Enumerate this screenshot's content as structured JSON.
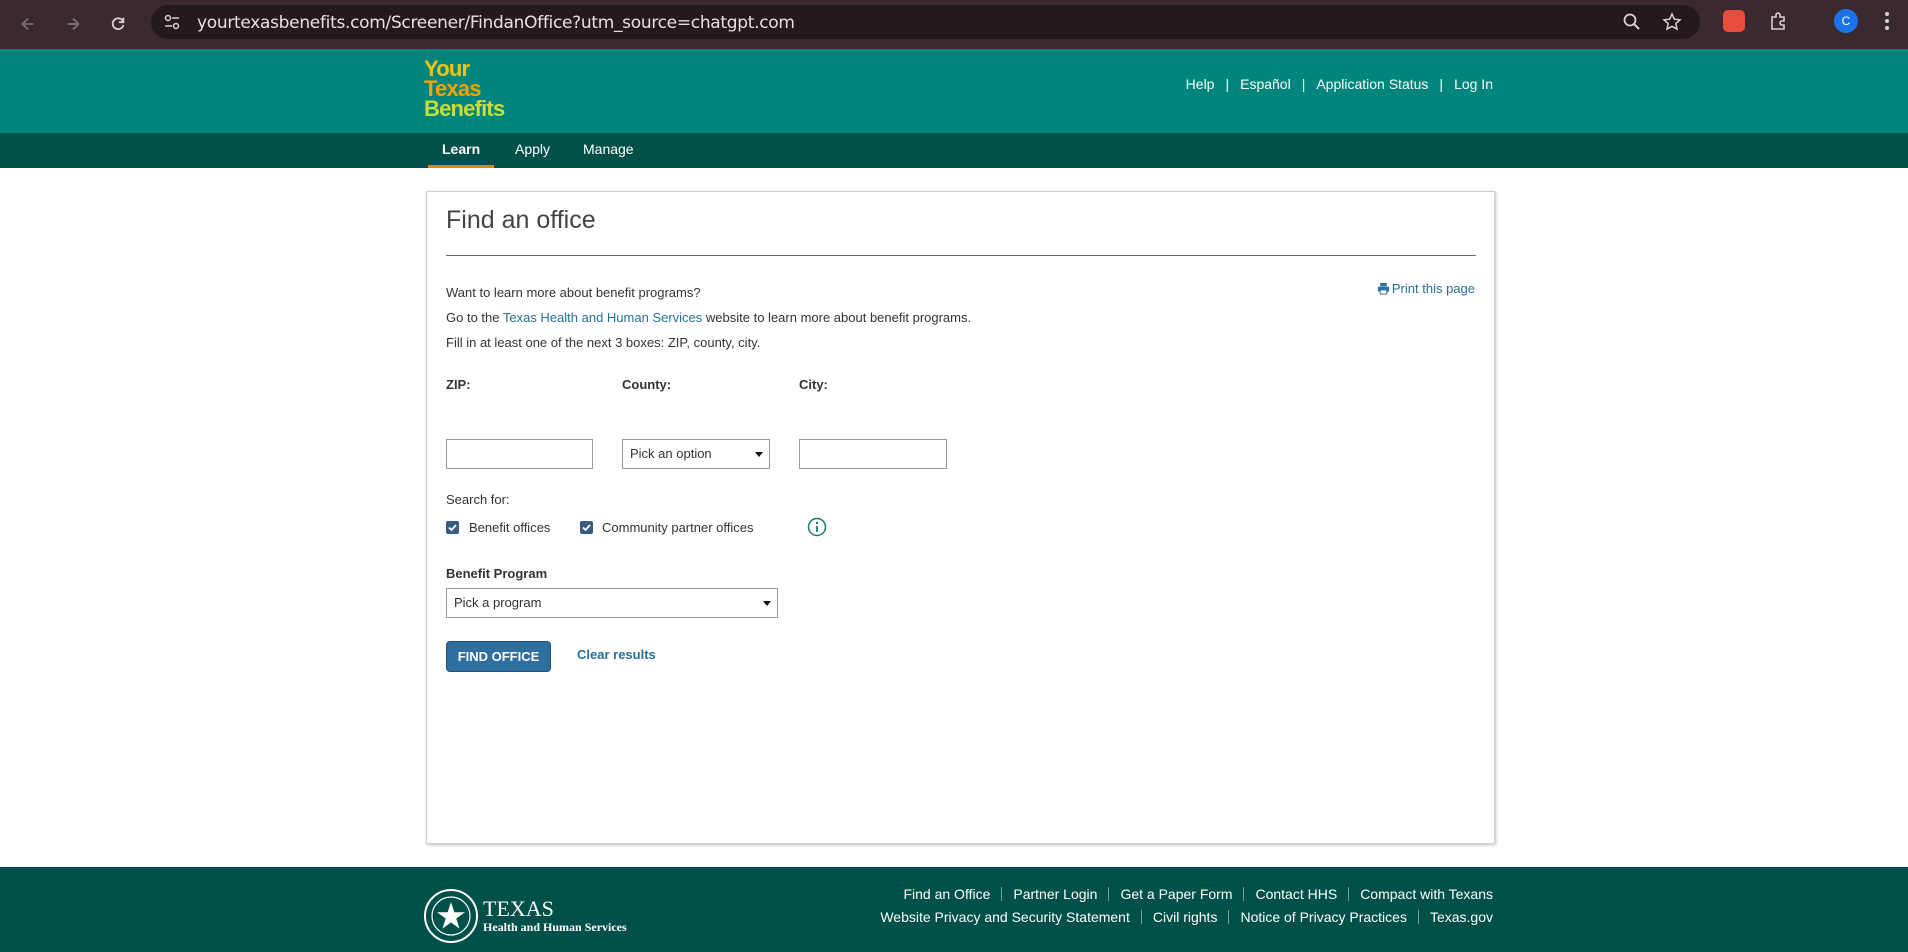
{
  "browser": {
    "url": "yourtexasbenefits.com/Screener/FindanOffice?utm_source=chatgpt.com",
    "profile_initial": "C"
  },
  "header": {
    "logo": [
      "Your",
      "Texas",
      "Benefits"
    ],
    "utility_links": [
      "Help",
      "Español",
      "Application Status",
      "Log In"
    ],
    "separator": "|"
  },
  "nav": {
    "tabs": [
      "Learn",
      "Apply",
      "Manage"
    ],
    "active_tab": "Learn"
  },
  "main": {
    "title": "Find an office",
    "print_label": "Print this page",
    "intro": "Want to learn more about benefit programs?",
    "go_prefix": "Go to the ",
    "hhs_link": "Texas Health and Human Services",
    "go_suffix": " website to learn more about benefit programs.",
    "fill_note": "Fill in at least one of the next 3 boxes: ZIP, county, city.",
    "zip_label": "ZIP:",
    "zip_value": "",
    "county_label": "County:",
    "county_value": "Pick an option",
    "city_label": "City:",
    "city_value": "",
    "search_for_label": "Search for:",
    "benefit_offices_label": "Benefit offices",
    "benefit_offices_checked": true,
    "community_offices_label": "Community partner offices",
    "community_offices_checked": true,
    "program_label": "Benefit Program",
    "program_value": "Pick a program",
    "find_button": "FIND OFFICE",
    "clear_link": "Clear results"
  },
  "footer": {
    "logo_title": "TEXAS",
    "logo_subtitle": "Health and Human Services",
    "row1": [
      "Find an Office",
      "Partner Login",
      "Get a Paper Form",
      "Contact HHS",
      "Compact with Texans"
    ],
    "row2": [
      "Website Privacy and Security Statement",
      "Civil rights",
      "Notice of Privacy Practices",
      "Texas.gov"
    ]
  },
  "colors": {
    "header_teal": "#00857c",
    "nav_dark": "#00504a",
    "active_underline": "#d88a1e",
    "button_blue": "#2f6fa0",
    "link_blue": "#2a6f9a"
  }
}
